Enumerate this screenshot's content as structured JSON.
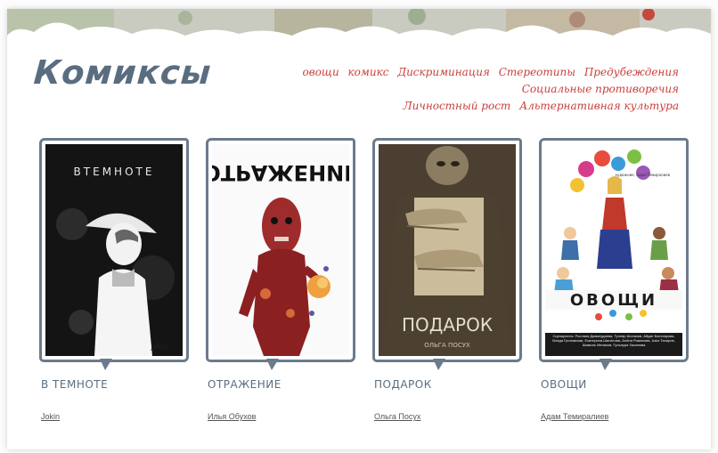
{
  "site": {
    "logo": "Комиксы"
  },
  "tags": [
    "овощи",
    "комикс",
    "Дискриминация",
    "Стереотипы",
    "Предубеждения",
    "Социальные противоречия",
    "Личностный рост",
    "Альтернативная культура"
  ],
  "comics": [
    {
      "title": "В ТЕМНОТЕ",
      "author": "Jokin",
      "cover_title": "ВТЕМНОТЕ",
      "cover_signature": "Jokin"
    },
    {
      "title": "ОТРАЖЕНИЕ",
      "author": "Илья Обухов",
      "cover_title": "ОТРАЖЕНИЕ"
    },
    {
      "title": "ПОДАРОК",
      "author": "Ольга Посух",
      "cover_title": "ПОДАРОК",
      "cover_author": "ОЛЬГА ПОСУХ"
    },
    {
      "title": "ОВОЩИ",
      "author": "Адам Темиралиев",
      "cover_title": "ОВОЩИ",
      "cover_artist": "художник: Адам Темиралиев",
      "cover_credits": "Сценаристы: Рослана Джамгудаева, Тулпар Шоназов, Айдат Бахтиярова, Влада Гроновская, Екатерина Шатилова, Алёна Романова, Азиз Тахиров, Шамиль Меликов, Гульнура Хасанова"
    }
  ]
}
